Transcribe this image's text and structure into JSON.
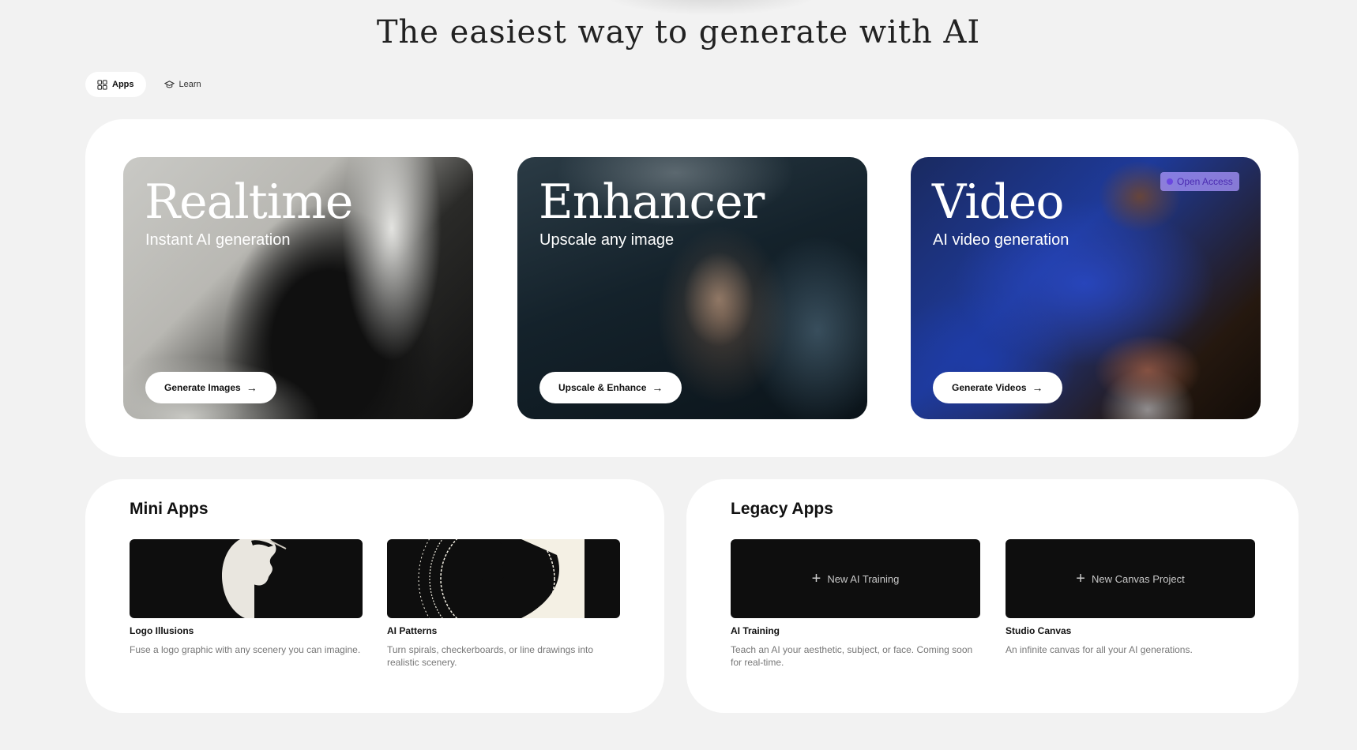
{
  "header": {
    "title": "The easiest way to generate with AI"
  },
  "tabs": [
    {
      "label": "Apps",
      "icon": "grid-icon",
      "active": true
    },
    {
      "label": "Learn",
      "icon": "graduation-cap-icon",
      "active": false
    }
  ],
  "featured": [
    {
      "title": "Realtime",
      "subtitle": "Instant AI generation",
      "button": "Generate Images"
    },
    {
      "title": "Enhancer",
      "subtitle": "Upscale any image",
      "button": "Upscale & Enhance"
    },
    {
      "title": "Video",
      "subtitle": "AI video generation",
      "button": "Generate Videos",
      "badge": "Open Access"
    }
  ],
  "mini_apps": {
    "heading": "Mini Apps",
    "items": [
      {
        "name": "Logo Illusions",
        "description": "Fuse a logo graphic with any scenery you can imagine."
      },
      {
        "name": "AI Patterns",
        "description": "Turn spirals, checkerboards, or line drawings into realistic scenery."
      }
    ]
  },
  "legacy_apps": {
    "heading": "Legacy Apps",
    "items": [
      {
        "name": "AI Training",
        "action": "New AI Training",
        "description": "Teach an AI your aesthetic, subject, or face. Coming soon for real-time."
      },
      {
        "name": "Studio Canvas",
        "action": "New Canvas Project",
        "description": "An infinite canvas for all your AI generations."
      }
    ]
  },
  "colors": {
    "page_bg": "#f2f2f2",
    "panel_bg": "#ffffff",
    "badge_bg": "#b5a3ff",
    "badge_text": "#4a2bb0"
  }
}
